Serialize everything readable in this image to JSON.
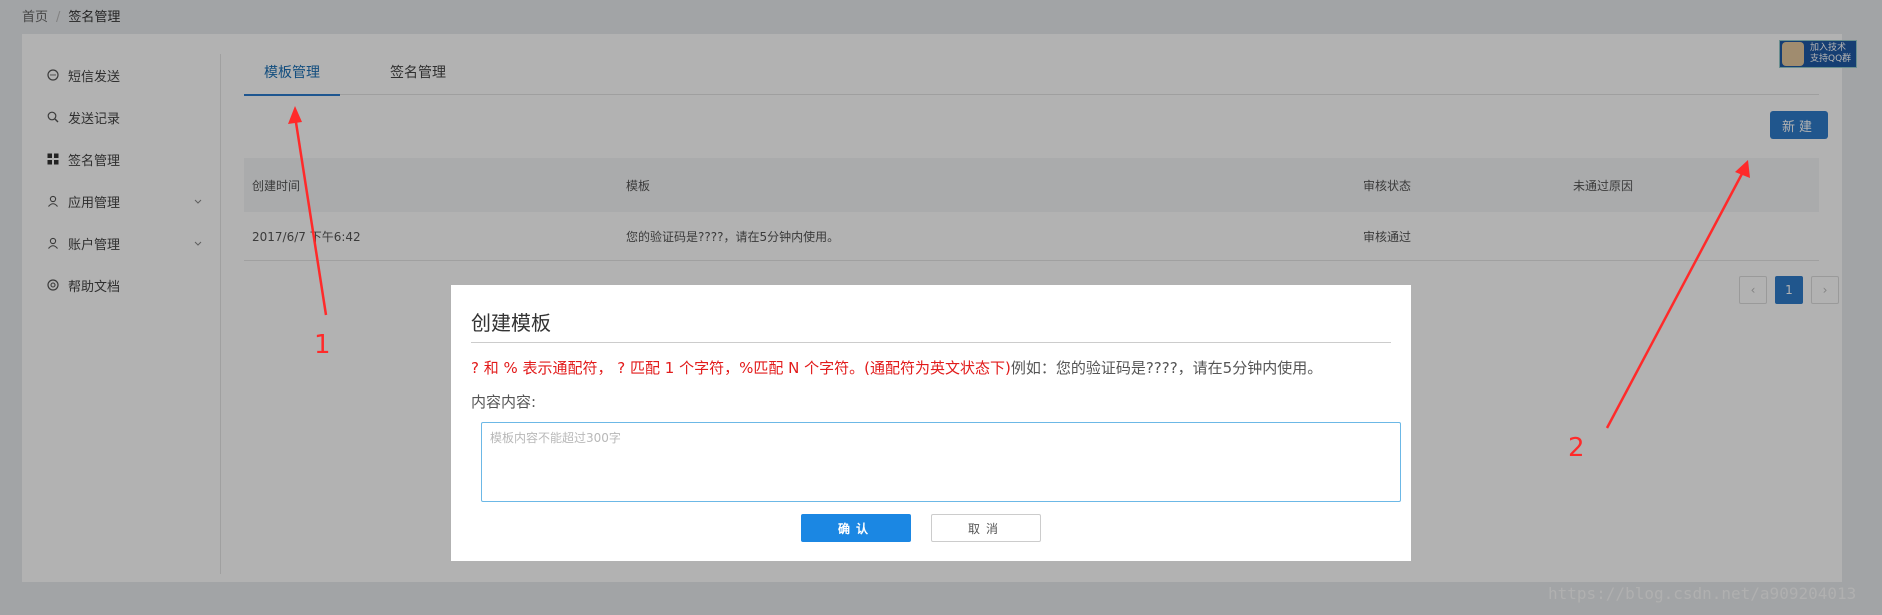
{
  "breadcrumb": {
    "home": "首页",
    "separator": "/",
    "current": "签名管理"
  },
  "sidebar": {
    "items": [
      {
        "label": "短信发送",
        "icon": "chat-icon"
      },
      {
        "label": "发送记录",
        "icon": "search-icon"
      },
      {
        "label": "签名管理",
        "icon": "grid-icon"
      },
      {
        "label": "应用管理",
        "icon": "user-icon",
        "expandable": true
      },
      {
        "label": "账户管理",
        "icon": "user-icon",
        "expandable": true
      },
      {
        "label": "帮助文档",
        "icon": "help-icon"
      }
    ]
  },
  "tabs": [
    {
      "label": "模板管理",
      "active": true
    },
    {
      "label": "签名管理",
      "active": false
    }
  ],
  "toolbar": {
    "new_label": "新建"
  },
  "qq_badge": {
    "line1": "加入技术",
    "line2": "支持QQ群"
  },
  "table": {
    "columns": [
      "创建时间",
      "模板",
      "审核状态",
      "未通过原因"
    ],
    "rows": [
      [
        "2017/6/7 下午6:42",
        "您的验证码是????，请在5分钟内使用。",
        "审核通过",
        ""
      ]
    ]
  },
  "pagination": {
    "prev": "‹",
    "current": "1",
    "next": "›"
  },
  "modal": {
    "title": "创建模板",
    "hint_red": "? 和 % 表示通配符， ? 匹配 1 个字符，%匹配 N 个字符。(通配符为英文状态下)",
    "hint_gray": "例如：您的验证码是????，请在5分钟内使用。",
    "content_label": "内容内容:",
    "content_placeholder": "模板内容不能超过300字",
    "content_value": "",
    "ok_label": "确认",
    "cancel_label": "取消"
  },
  "annotations": {
    "arrow1_label": "1",
    "arrow2_label": "2",
    "color": "#ff2a2a"
  },
  "watermark": "https://blog.csdn.net/a909204013",
  "colors": {
    "accent": "#2e7ccb",
    "confirm": "#1b87e3",
    "annotation": "#ff2a2a",
    "hint": "#e21b1b"
  }
}
